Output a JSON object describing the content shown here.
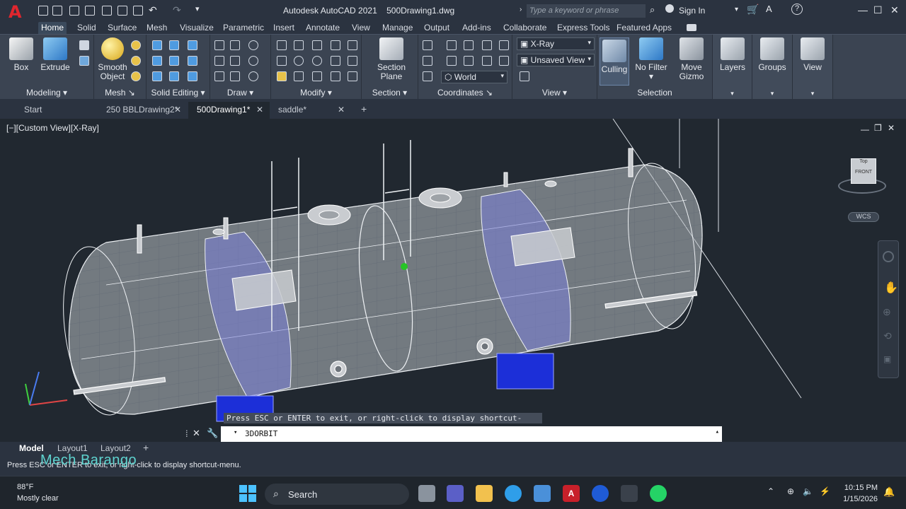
{
  "titlebar": {
    "app_title": "Autodesk AutoCAD 2021",
    "file_name": "500Drawing1.dwg",
    "search_placeholder": "Type a keyword or phrase",
    "sign_in": "Sign In"
  },
  "ribbon_tabs": [
    "Home",
    "Solid",
    "Surface",
    "Mesh",
    "Visualize",
    "Parametric",
    "Insert",
    "Annotate",
    "View",
    "Manage",
    "Output",
    "Add-ins",
    "Collaborate",
    "Express Tools",
    "Featured Apps"
  ],
  "ribbon": {
    "modeling": {
      "label": "Modeling",
      "box": "Box",
      "extrude": "Extrude"
    },
    "mesh": {
      "label": "Mesh",
      "smooth_object_1": "Smooth",
      "smooth_object_2": "Object"
    },
    "solid_editing": {
      "label": "Solid Editing"
    },
    "draw": {
      "label": "Draw"
    },
    "modify": {
      "label": "Modify"
    },
    "section": {
      "label": "Section",
      "plane_1": "Section",
      "plane_2": "Plane"
    },
    "coordinates": {
      "label": "Coordinates",
      "world": "World"
    },
    "view": {
      "label": "View",
      "visual_style": "X-Ray",
      "saved_view": "Unsaved View"
    },
    "selection": {
      "label": "Selection",
      "culling": "Culling",
      "no_filter": "No Filter",
      "move_gizmo_1": "Move",
      "move_gizmo_2": "Gizmo"
    },
    "layers": "Layers",
    "groups": "Groups",
    "view_btn": "View"
  },
  "file_tabs": [
    {
      "label": "Start"
    },
    {
      "label": "250 BBLDrawing2*"
    },
    {
      "label": "500Drawing1*"
    },
    {
      "label": "saddle*"
    }
  ],
  "viewport": {
    "label": "[−][Custom View][X-Ray]",
    "viewcube_face": "FRONT",
    "viewcube_top": "Top",
    "wcs": "WCS"
  },
  "command": {
    "hint": "Press ESC or ENTER to exit, or right-click to display shortcut-menu.",
    "current": "3DORBIT"
  },
  "layout_tabs": [
    "Model",
    "Layout1",
    "Layout2"
  ],
  "status": {
    "message": "Press ESC or ENTER to exit, or right-click to display shortcut-menu.",
    "watermark": "Mech Barango"
  },
  "taskbar": {
    "temperature": "88°F",
    "weather": "Mostly clear",
    "search": "Search",
    "time": "10:15 PM",
    "date": "1/15/2026"
  },
  "colors": {
    "accent": "#e0262e",
    "ribbon": "#3b4452",
    "viewport": "#212830"
  }
}
